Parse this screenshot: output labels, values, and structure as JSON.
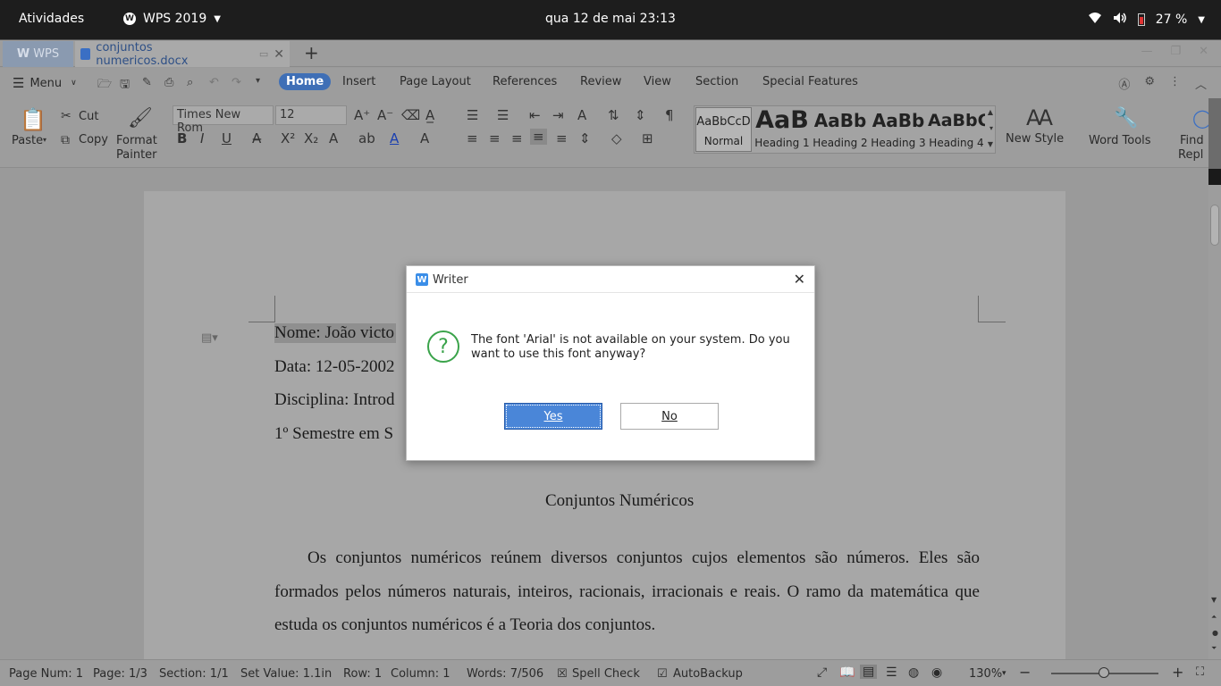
{
  "topbar": {
    "activities": "Atividades",
    "app_name": "WPS 2019",
    "clock": "qua 12 de mai  23:13",
    "battery": "27 %"
  },
  "tabs": {
    "home_tab": "WPS",
    "doc_tab": "conjuntos numericos.docx"
  },
  "menu": {
    "menu_label": "Menu",
    "ribbon_tabs": [
      "Home",
      "Insert",
      "Page Layout",
      "References",
      "Review",
      "View",
      "Section",
      "Special Features"
    ]
  },
  "toolbar": {
    "cut": "Cut",
    "copy": "Copy",
    "paste": "Paste",
    "format_painter_1": "Format",
    "format_painter_2": "Painter",
    "font_name": "Times New Rom",
    "font_size": "12",
    "styles": [
      {
        "preview": "AaBbCcD",
        "name": "Normal"
      },
      {
        "preview": "AaB",
        "name": "Heading 1"
      },
      {
        "preview": "AaBb",
        "name": "Heading 2"
      },
      {
        "preview": "AaBb",
        "name": "Heading 3"
      },
      {
        "preview": "AaBbC",
        "name": "Heading 4"
      }
    ],
    "new_style": "New Style",
    "word_tools": "Word Tools",
    "find_1": "Find",
    "find_2": "Repl"
  },
  "document": {
    "lines": [
      "Nome: João victo",
      "Data: 12-05-2002",
      "Disciplina: Introd",
      "1º Semestre em S"
    ],
    "title": "Conjuntos Numéricos",
    "paragraph": "Os conjuntos numéricos reúnem diversos conjuntos cujos elementos são números. Eles são formados pelos números naturais, inteiros, racionais, irracionais e reais. O ramo da matemática que estuda os conjuntos numéricos é a Teoria dos conjuntos."
  },
  "dialog": {
    "title": "Writer",
    "message": "The font 'Arial' is not available on your system. Do you want to use this font anyway?",
    "yes": "Yes",
    "no": "No"
  },
  "statusbar": {
    "page_num": "Page Num: 1",
    "page": "Page: 1/3",
    "section": "Section: 1/1",
    "set_value": "Set Value: 1.1in",
    "row": "Row: 1",
    "column": "Column: 1",
    "words": "Words: 7/506",
    "spell_check": "Spell Check",
    "autobackup": "AutoBackup",
    "zoom": "130%"
  }
}
